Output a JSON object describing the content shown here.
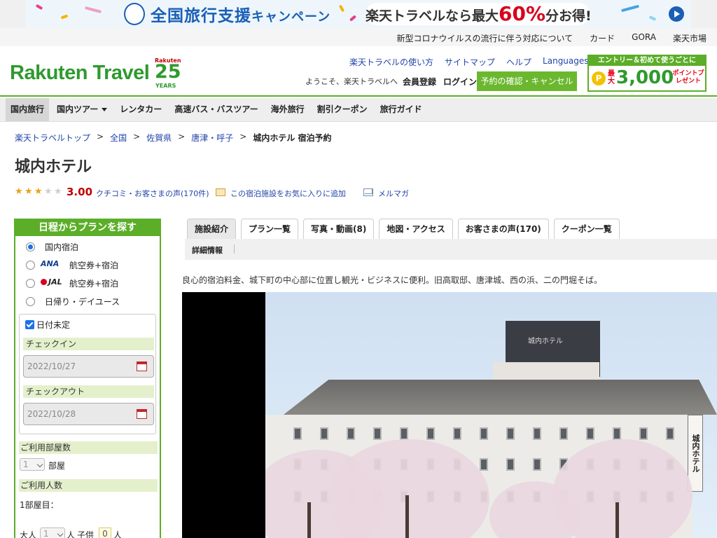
{
  "banner": {
    "left_text": "全国旅行支援",
    "left_text_small": "キャンペーン",
    "pill_prefix": "楽天トラベルなら最大",
    "pill_big": "60%",
    "pill_suffix": "分お得!"
  },
  "util_links": [
    "新型コロナウイルスの流行に伴う対応について",
    "カード",
    "GORA",
    "楽天市場"
  ],
  "header": {
    "logo": "Rakuten Travel",
    "badge_rakuten": "Rakuten",
    "badge_number": "25",
    "badge_years": "YEARS",
    "links": [
      "楽天トラベルの使い方",
      "サイトマップ",
      "ヘルプ",
      "Languages"
    ],
    "welcome": "ようこそ、楽天トラベルへ",
    "register": "会員登録",
    "login": "ログイン",
    "reserve_button": "予約の確認・キャンセル",
    "entry_top": "エントリー＆初めて使うごとに",
    "entry_coin": "P",
    "entry_max": "最大",
    "entry_number": "3,000",
    "entry_points": "ポイントプレゼント"
  },
  "nav": [
    "国内旅行",
    "国内ツアー",
    "レンタカー",
    "高速バス・バスツアー",
    "海外旅行",
    "割引クーポン",
    "旅行ガイド"
  ],
  "breadcrumb": {
    "links": [
      "楽天トラベルトップ",
      "全国",
      "佐賀県",
      "唐津・呼子"
    ],
    "current": "城内ホテル 宿泊予約",
    "separator": ">"
  },
  "hotel": {
    "name": "城内ホテル",
    "rating": 3.0,
    "score": "3.00",
    "reviews_link": "クチコミ・お客さまの声(170件)",
    "favorite_link": "この宿泊施設をお気に入りに追加",
    "mail_link": "メルマガ",
    "description": "良心的宿泊料金、城下町の中心部に位置し観光・ビジネスに便利。旧高取邸、唐津城、西の浜、二の門堀そば。"
  },
  "search": {
    "title": "日程からプランを探す",
    "options": [
      {
        "label": "国内宿泊",
        "logo": "",
        "selected": true
      },
      {
        "label": "航空券+宿泊",
        "logo": "ANA",
        "selected": false
      },
      {
        "label": "航空券+宿泊",
        "logo": "JAL",
        "selected": false
      },
      {
        "label": "日帰り・デイユース",
        "logo": "",
        "selected": false
      }
    ],
    "date_undecided": "日付未定",
    "checkin_label": "チェックイン",
    "checkin_value": "2022/10/27",
    "checkout_label": "チェックアウト",
    "checkout_value": "2022/10/28",
    "rooms_label": "ご利用部屋数",
    "rooms_value": "1",
    "rooms_unit": "部屋",
    "people_label": "ご利用人数",
    "room1_label": "1部屋目：",
    "adult_label": "大人",
    "adult_value": "1",
    "person_unit": "人",
    "child_label": "子供",
    "child_value": "0"
  },
  "tabs": [
    "施設紹介",
    "プラン一覧",
    "写真・動画(8)",
    "地図・アクセス",
    "お客さまの声(170)",
    "クーポン一覧"
  ],
  "subtab": "詳細情報",
  "photo": {
    "building_label": "城内ホテル",
    "sign_text": "城内ホテル"
  },
  "colors": {
    "brand_green": "#5cae29",
    "rating_red": "#bf0000",
    "link_blue": "#2244aa"
  }
}
